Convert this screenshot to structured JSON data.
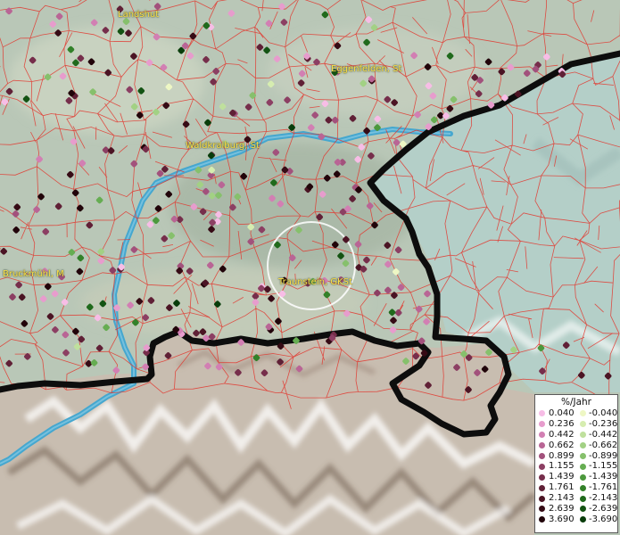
{
  "places": [
    {
      "key": "landshut",
      "name": "Landshut"
    },
    {
      "key": "eggenfelden",
      "name": "Eggenfelden, St"
    },
    {
      "key": "waldkraiburg",
      "name": "Waldkraiburg, St"
    },
    {
      "key": "bruckmuehl",
      "name": "Bruckmühl, M"
    },
    {
      "key": "traunstein",
      "name": "Traunstein, GKSt"
    }
  ],
  "legend": {
    "title": "%/Jahr",
    "rows": [
      {
        "pos": "0.040",
        "pos_color": "#f7bde6",
        "neg": "-0.040",
        "neg_color": "#eef7c4"
      },
      {
        "pos": "0.236",
        "pos_color": "#e79ccd",
        "neg": "-0.236",
        "neg_color": "#d6edb0"
      },
      {
        "pos": "0.442",
        "pos_color": "#d27fb3",
        "neg": "-0.442",
        "neg_color": "#bfe09d"
      },
      {
        "pos": "0.662",
        "pos_color": "#b96595",
        "neg": "-0.662",
        "neg_color": "#a2d184"
      },
      {
        "pos": "0.899",
        "pos_color": "#a2517c",
        "neg": "-0.899",
        "neg_color": "#86c06c"
      },
      {
        "pos": "1.155",
        "pos_color": "#8c3f63",
        "neg": "-1.155",
        "neg_color": "#66ad52"
      },
      {
        "pos": "1.439",
        "pos_color": "#762e4b",
        "neg": "-1.439",
        "neg_color": "#4c983d"
      },
      {
        "pos": "1.761",
        "pos_color": "#602036",
        "neg": "-1.761",
        "neg_color": "#338129"
      },
      {
        "pos": "2.143",
        "pos_color": "#4b1424",
        "neg": "-2.143",
        "neg_color": "#206a1c"
      },
      {
        "pos": "2.639",
        "pos_color": "#360b15",
        "neg": "-2.639",
        "neg_color": "#135313"
      },
      {
        "pos": "3.690",
        "pos_color": "#21040a",
        "neg": "-3.690",
        "neg_color": "#093d0b"
      }
    ]
  },
  "colors": {
    "lowland": "#b9c7b7",
    "mountains": "#c9bfb2",
    "lake": "#b4cfc8",
    "river": "#45a7cf",
    "boundaries": "#e2382f",
    "border": "#0d0d0d",
    "label": "#ffe24a"
  }
}
